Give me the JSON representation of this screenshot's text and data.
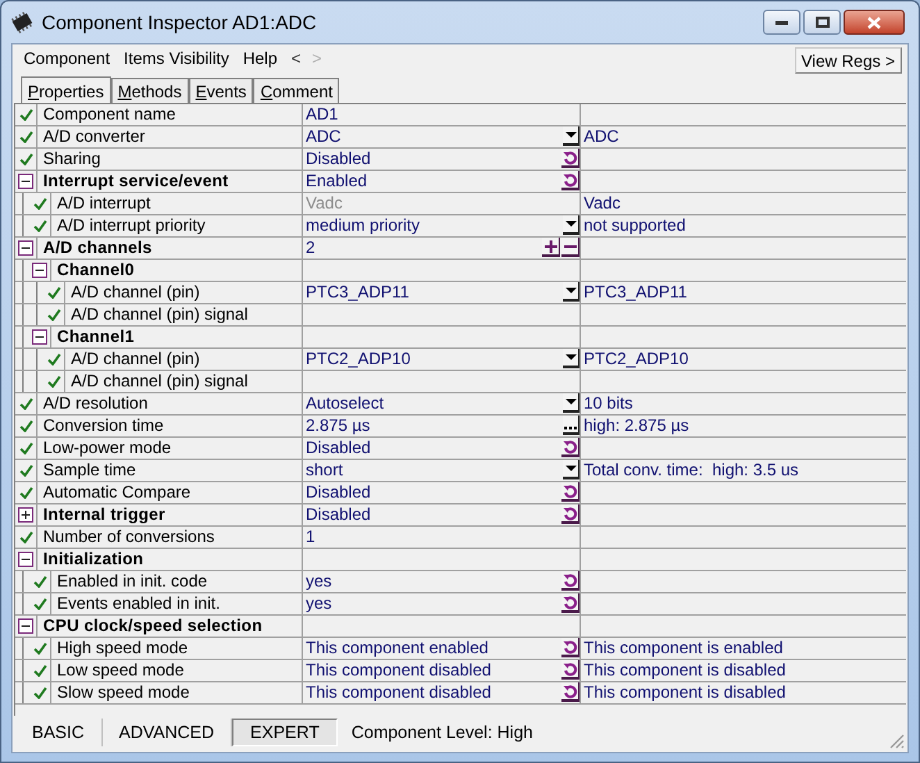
{
  "window": {
    "title": "Component Inspector AD1:ADC"
  },
  "menu": [
    {
      "label": "Component"
    },
    {
      "label": "Items Visibility"
    },
    {
      "label": "Help"
    }
  ],
  "nav": [
    {
      "label": "<",
      "disabled": false
    },
    {
      "label": ">",
      "disabled": true
    }
  ],
  "view_regs_button": "View Regs >",
  "tabs": [
    {
      "label": "Properties",
      "selected": true
    },
    {
      "label": "Methods",
      "selected": false
    },
    {
      "label": "Events",
      "selected": false
    },
    {
      "label": "Comment",
      "selected": false
    }
  ],
  "properties": [
    {
      "kind": "item",
      "name": "Component name",
      "value": "AD1",
      "disabled": false
    },
    {
      "kind": "item",
      "name": "A/D converter",
      "value": "ADC",
      "editor": {
        "kind": "dropdown"
      },
      "info": "ADC",
      "disabled": false
    },
    {
      "kind": "item",
      "name": "Sharing",
      "value": "Disabled",
      "editor": {
        "kind": "reset"
      },
      "disabled": false
    },
    {
      "kind": "group",
      "name": "Interrupt service/event",
      "value": "Enabled",
      "editor": {
        "kind": "reset"
      },
      "expanded": true,
      "disabled": false,
      "children": [
        {
          "kind": "item",
          "name": "A/D interrupt",
          "value": "Vadc",
          "info": "Vadc",
          "disabled": true
        },
        {
          "kind": "item",
          "name": "A/D interrupt priority",
          "value": "medium priority",
          "editor": {
            "kind": "dropdown"
          },
          "info": "not supported",
          "disabled": false
        }
      ]
    },
    {
      "kind": "group",
      "name": "A/D channels",
      "value": "2",
      "editor": {
        "kind": "plusminus"
      },
      "expanded": true,
      "disabled": false,
      "children": [
        {
          "kind": "group",
          "name": "Channel0",
          "expanded": true,
          "children": [
            {
              "kind": "item",
              "name": "A/D channel (pin)",
              "value": "PTC3_ADP11",
              "editor": {
                "kind": "dropdown"
              },
              "info": "PTC3_ADP11",
              "disabled": false
            },
            {
              "kind": "item",
              "name": "A/D channel (pin) signal"
            }
          ]
        },
        {
          "kind": "group",
          "name": "Channel1",
          "expanded": true,
          "children": [
            {
              "kind": "item",
              "name": "A/D channel (pin)",
              "value": "PTC2_ADP10",
              "editor": {
                "kind": "dropdown"
              },
              "info": "PTC2_ADP10",
              "disabled": false
            },
            {
              "kind": "item",
              "name": "A/D channel (pin) signal"
            }
          ]
        }
      ]
    },
    {
      "kind": "item",
      "name": "A/D resolution",
      "value": "Autoselect",
      "editor": {
        "kind": "dropdown"
      },
      "info": "10 bits",
      "disabled": false
    },
    {
      "kind": "item",
      "name": "Conversion time",
      "value": "2.875 µs",
      "editor": {
        "kind": "ellipsis"
      },
      "info": "high: 2.875 µs",
      "disabled": false
    },
    {
      "kind": "item",
      "name": "Low-power mode",
      "value": "Disabled",
      "editor": {
        "kind": "reset"
      },
      "disabled": false
    },
    {
      "kind": "item",
      "name": "Sample time",
      "value": "short",
      "editor": {
        "kind": "dropdown"
      },
      "info": "Total conv. time:  high: 3.5 us",
      "disabled": false
    },
    {
      "kind": "item",
      "name": "Automatic Compare",
      "value": "Disabled",
      "editor": {
        "kind": "reset"
      },
      "disabled": false
    },
    {
      "kind": "group",
      "name": "Internal trigger",
      "value": "Disabled",
      "editor": {
        "kind": "reset"
      },
      "expanded": false,
      "disabled": false
    },
    {
      "kind": "item",
      "name": "Number of conversions",
      "value": "1",
      "disabled": false
    },
    {
      "kind": "group",
      "name": "Initialization",
      "expanded": true,
      "children": [
        {
          "kind": "item",
          "name": "Enabled in init. code",
          "value": "yes",
          "editor": {
            "kind": "reset"
          },
          "disabled": false
        },
        {
          "kind": "item",
          "name": "Events enabled in init.",
          "value": "yes",
          "editor": {
            "kind": "reset"
          },
          "disabled": false
        }
      ]
    },
    {
      "kind": "group",
      "name": "CPU clock/speed selection",
      "expanded": true,
      "children": [
        {
          "kind": "item",
          "name": "High speed mode",
          "value": "This component enabled",
          "editor": {
            "kind": "reset"
          },
          "info": "This component is enabled",
          "disabled": false
        },
        {
          "kind": "item",
          "name": "Low speed mode",
          "value": "This component disabled",
          "editor": {
            "kind": "reset"
          },
          "info": "This component is disabled",
          "disabled": false
        },
        {
          "kind": "item",
          "name": "Slow speed mode",
          "value": "This component disabled",
          "editor": {
            "kind": "reset"
          },
          "info": "This component is disabled",
          "disabled": false
        }
      ]
    }
  ],
  "levels": [
    {
      "label": "BASIC",
      "selected": false
    },
    {
      "label": "ADVANCED",
      "selected": false
    },
    {
      "label": "EXPERT",
      "selected": true
    }
  ],
  "component_level": "Component Level: High"
}
